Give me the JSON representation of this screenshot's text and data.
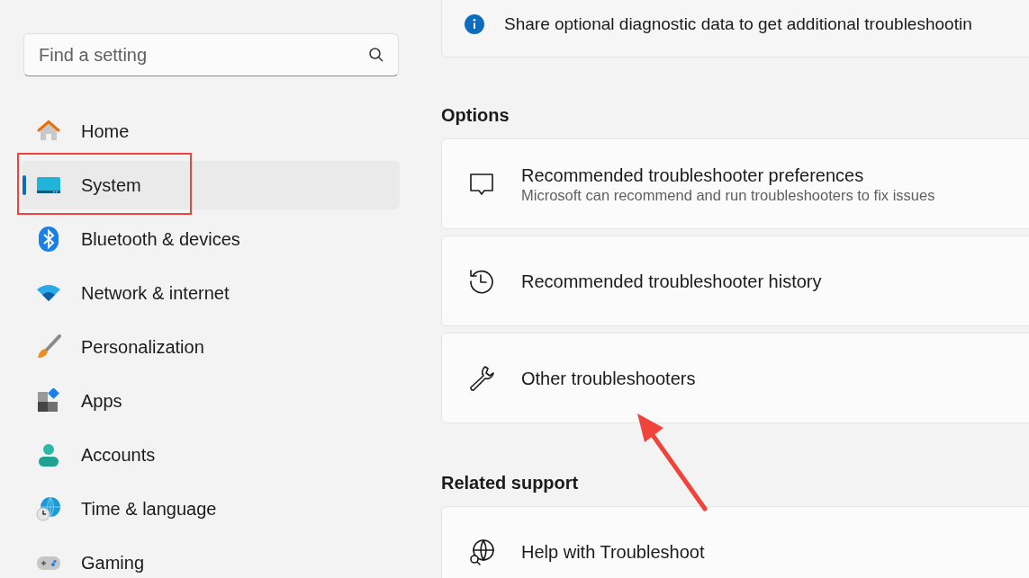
{
  "search": {
    "placeholder": "Find a setting"
  },
  "nav": [
    {
      "label": "Home",
      "kind": "home",
      "selected": false
    },
    {
      "label": "System",
      "kind": "system",
      "selected": true
    },
    {
      "label": "Bluetooth & devices",
      "kind": "bluetooth",
      "selected": false
    },
    {
      "label": "Network & internet",
      "kind": "network",
      "selected": false
    },
    {
      "label": "Personalization",
      "kind": "brush",
      "selected": false
    },
    {
      "label": "Apps",
      "kind": "apps",
      "selected": false
    },
    {
      "label": "Accounts",
      "kind": "person",
      "selected": false
    },
    {
      "label": "Time & language",
      "kind": "time",
      "selected": false
    },
    {
      "label": "Gaming",
      "kind": "gaming",
      "selected": false
    }
  ],
  "notice": {
    "text": "Share optional diagnostic data to get additional troubleshootin"
  },
  "sections": [
    {
      "title": "Options",
      "items": [
        {
          "title": "Recommended troubleshooter preferences",
          "subtitle": "Microsoft can recommend and run troubleshooters to fix issues",
          "kind": "feedback"
        },
        {
          "title": "Recommended troubleshooter history",
          "kind": "history"
        },
        {
          "title": "Other troubleshooters",
          "kind": "wrench"
        }
      ]
    },
    {
      "title": "Related support",
      "items": [
        {
          "title": "Help with Troubleshoot",
          "kind": "globe"
        }
      ]
    }
  ],
  "annotations": {
    "highlight_box": true,
    "arrow": true
  }
}
